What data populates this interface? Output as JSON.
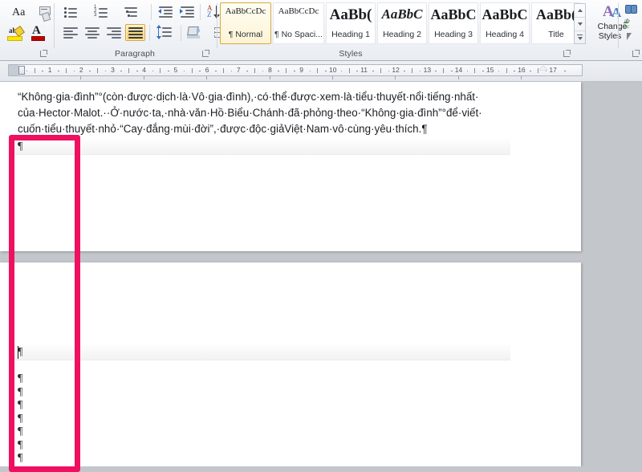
{
  "app": {
    "name": "Microsoft Word",
    "ribbon_tab": "Home"
  },
  "ribbon": {
    "groups": [
      {
        "id": "font",
        "label": ""
      },
      {
        "id": "paragraph",
        "label": "Paragraph"
      },
      {
        "id": "styles",
        "label": "Styles"
      },
      {
        "id": "editing",
        "label": ""
      }
    ],
    "font_group": {
      "buttons": [
        {
          "name": "change-case-button",
          "label": "Aa",
          "icon": "change-case-icon",
          "has_caret": true
        },
        {
          "name": "clear-formatting-button",
          "label": "",
          "icon": "clear-formatting-icon",
          "has_caret": false
        },
        {
          "name": "text-highlight-color-button",
          "label": "ab",
          "icon": "highlight-icon",
          "has_caret": true,
          "color": "#ffe400"
        },
        {
          "name": "font-color-button",
          "label": "A",
          "icon": "font-color-icon",
          "has_caret": true,
          "color": "#c00000"
        }
      ]
    },
    "paragraph_group": {
      "label": "Paragraph",
      "row1": [
        {
          "name": "bullets-button",
          "icon": "bullets-icon",
          "has_caret": true,
          "active": false
        },
        {
          "name": "numbering-button",
          "icon": "numbering-icon",
          "has_caret": true,
          "active": false
        },
        {
          "name": "multilevel-list-button",
          "icon": "multilevel-list-icon",
          "has_caret": true,
          "active": false
        },
        {
          "name": "decrease-indent-button",
          "icon": "decrease-indent-icon",
          "has_caret": false,
          "active": false
        },
        {
          "name": "increase-indent-button",
          "icon": "increase-indent-icon",
          "has_caret": false,
          "active": false
        },
        {
          "name": "sort-button",
          "icon": "sort-az-icon",
          "has_caret": false,
          "active": false
        },
        {
          "name": "show-formatting-marks-button",
          "icon": "pilcrow-icon",
          "has_caret": false,
          "active": true
        }
      ],
      "row2": [
        {
          "name": "align-left-button",
          "icon": "align-left-icon",
          "active": false
        },
        {
          "name": "align-center-button",
          "icon": "align-center-icon",
          "active": false
        },
        {
          "name": "align-right-button",
          "icon": "align-right-icon",
          "active": false
        },
        {
          "name": "justify-button",
          "icon": "justify-icon",
          "active": true
        },
        {
          "name": "line-spacing-button",
          "icon": "line-spacing-icon",
          "has_caret": true,
          "active": false
        },
        {
          "name": "shading-button",
          "icon": "shading-bucket-icon",
          "has_caret": true,
          "active": false
        },
        {
          "name": "borders-button",
          "icon": "borders-grid-icon",
          "has_caret": true,
          "active": false
        }
      ]
    },
    "styles_group": {
      "label": "Styles",
      "items": [
        {
          "preview": "AaBbCcDc",
          "label": "¶ Normal",
          "selected": true,
          "preview_style": "serif-small"
        },
        {
          "preview": "AaBbCcDc",
          "label": "¶ No Spaci...",
          "selected": false,
          "preview_style": "serif-small"
        },
        {
          "preview": "AaBb(",
          "label": "Heading 1",
          "selected": false,
          "preview_style": "serif-big"
        },
        {
          "preview": "AaBbC",
          "label": "Heading 2",
          "selected": false,
          "preview_style": "serif-italic"
        },
        {
          "preview": "AaBbC",
          "label": "Heading 3",
          "selected": false,
          "preview_style": "serif-bigger"
        },
        {
          "preview": "AaBbC",
          "label": "Heading 4",
          "selected": false,
          "preview_style": "serif-bigger"
        },
        {
          "preview": "AaBb(",
          "label": "Title",
          "selected": false,
          "preview_style": "serif-bigger"
        }
      ],
      "scroll": [
        {
          "name": "styles-scroll-up-button",
          "icon": "chevron-up-icon"
        },
        {
          "name": "styles-scroll-down-button",
          "icon": "chevron-down-icon"
        },
        {
          "name": "styles-more-button",
          "icon": "more-styles-icon"
        }
      ],
      "change_styles": {
        "name": "change-styles-button",
        "line1": "Change",
        "line2": "Styles",
        "icon": "change-styles-icon"
      }
    },
    "editing_group": {
      "buttons": [
        {
          "name": "find-button",
          "icon": "binoculars-icon"
        },
        {
          "name": "replace-button",
          "icon": "replace-icon"
        },
        {
          "name": "select-button",
          "icon": "select-arrow-icon"
        }
      ]
    }
  },
  "ruler": {
    "ticks": [
      "1",
      "2",
      "3",
      "4",
      "5",
      "6",
      "7",
      "8",
      "9",
      "10",
      "11",
      "12",
      "13",
      "14",
      "15",
      "16",
      "17"
    ],
    "left_indent_marker": "hourglass-indent-marker",
    "right_indent_marker": "right-indent-marker"
  },
  "document": {
    "paragraph_mark": "¶",
    "page1": {
      "lines": [
        "“Không·gia·đình”°(còn·được·dịch·là·Vô·gia·đình),·có·thể·được·xem·là·tiểu·thuyết·nổi·tiếng·nhất·",
        "của·Hector·Malot.··Ở·nước·ta,·nhà·văn·Hồ·Biểu·Chánh·đã·phỏng·theo·“Không·gia·đình”°để·viết·",
        "cuốn·tiểu·thuyết·nhỏ·“Cay·đắng·mùi·đời”,·được·độc·giảViệt·Nam·vô·cùng·yêu·thích.¶"
      ],
      "empty_marks": [
        "¶"
      ]
    },
    "page2": {
      "cursor_line_mark": "¶",
      "empty_marks": [
        "¶",
        "¶",
        "¶",
        "¶",
        "¶",
        "¶",
        "¶"
      ]
    }
  },
  "annotation": {
    "name": "red-highlight-rectangle",
    "color": "#ef1060",
    "shape": "rectangle-outline"
  }
}
